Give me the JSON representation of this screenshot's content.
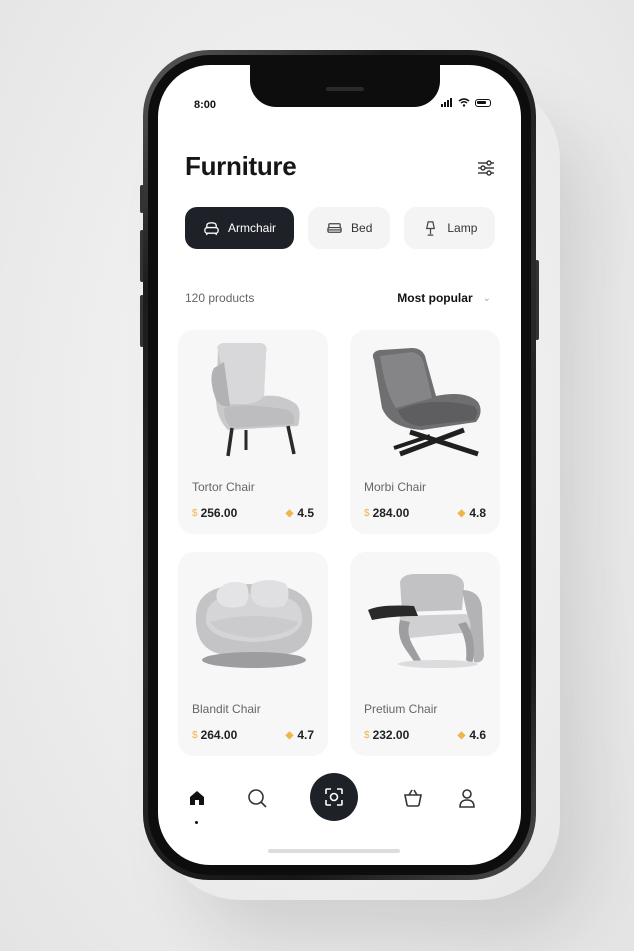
{
  "status": {
    "time": "8:00"
  },
  "header": {
    "title": "Furniture"
  },
  "categories": [
    {
      "label": "Armchair",
      "icon": "armchair-icon",
      "active": true
    },
    {
      "label": "Bed",
      "icon": "bed-icon",
      "active": false
    },
    {
      "label": "Lamp",
      "icon": "lamp-icon",
      "active": false
    }
  ],
  "listing": {
    "count_text": "120 products",
    "sort_label": "Most popular"
  },
  "products": [
    {
      "name": "Tortor Chair",
      "currency": "$",
      "price": "256.00",
      "rating": "4.5",
      "image": "wingback-armchair"
    },
    {
      "name": "Morbi Chair",
      "currency": "$",
      "price": "284.00",
      "rating": "4.8",
      "image": "lounge-chair"
    },
    {
      "name": "Blandit Chair",
      "currency": "$",
      "price": "264.00",
      "rating": "4.7",
      "image": "round-loveseat"
    },
    {
      "name": "Pretium Chair",
      "currency": "$",
      "price": "232.00",
      "rating": "4.6",
      "image": "modern-armchair"
    }
  ],
  "nav": {
    "items": [
      "home-icon",
      "search-icon",
      "scan-icon",
      "basket-icon",
      "profile-icon"
    ]
  },
  "colors": {
    "accent": "#1e2228",
    "star": "#f0b44a",
    "card": "#f7f7f8"
  }
}
